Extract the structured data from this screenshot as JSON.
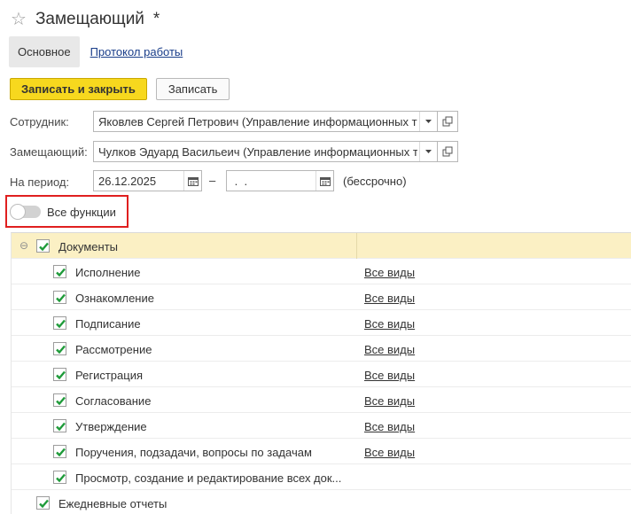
{
  "window": {
    "title": "Замещающий",
    "modified_marker": "*"
  },
  "tabs": [
    {
      "label": "Основное",
      "active": true
    },
    {
      "label": "Протокол работы",
      "active": false
    }
  ],
  "toolbar": {
    "save_close_label": "Записать и закрыть",
    "save_label": "Записать"
  },
  "form": {
    "employee": {
      "label": "Сотрудник:",
      "value": "Яковлев Сергей Петрович (Управление информационных технологий)"
    },
    "substitute": {
      "label": "Замещающий:",
      "value": "Чулков Эдуард Васильеич (Управление информационных технологий)"
    },
    "period": {
      "label": "На период:",
      "from": "26.12.2025",
      "to": " .  .",
      "to_suffix": "(бессрочно)"
    },
    "all_functions": {
      "label": "Все функции",
      "enabled": false
    }
  },
  "tree": {
    "group": {
      "label": "Документы",
      "checked": true,
      "expanded": true
    },
    "items": [
      {
        "label": "Исполнение",
        "checked": true,
        "kinds": "Все виды"
      },
      {
        "label": "Ознакомление",
        "checked": true,
        "kinds": "Все виды"
      },
      {
        "label": "Подписание",
        "checked": true,
        "kinds": "Все виды"
      },
      {
        "label": "Рассмотрение",
        "checked": true,
        "kinds": "Все виды"
      },
      {
        "label": "Регистрация",
        "checked": true,
        "kinds": "Все виды"
      },
      {
        "label": "Согласование",
        "checked": true,
        "kinds": "Все виды"
      },
      {
        "label": "Утверждение",
        "checked": true,
        "kinds": "Все виды"
      },
      {
        "label": "Поручения, подзадачи, вопросы по задачам",
        "checked": true,
        "kinds": "Все виды"
      },
      {
        "label": "Просмотр, создание и редактирование всех док...",
        "checked": true,
        "kinds": ""
      }
    ],
    "trailing": {
      "label": "Ежедневные отчеты",
      "checked": true
    }
  },
  "colors": {
    "accent_button": "#f7d81e",
    "group_row_bg": "#fbf0c4",
    "check_green": "#1f9b3a",
    "highlight_frame": "#e01f1f",
    "link": "#1a3e8a"
  },
  "icons": {
    "favorite": "star-icon",
    "dropdown": "chevron-down-icon",
    "open": "open-form-icon",
    "calendar": "calendar-icon",
    "collapse": "collapse-icon",
    "check": "checkmark-icon"
  }
}
